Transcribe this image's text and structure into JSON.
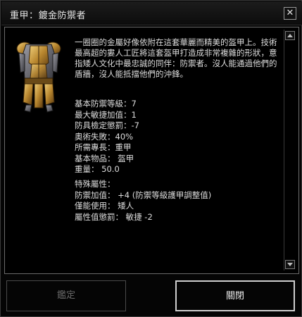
{
  "window": {
    "title": "重甲：鍍金防禦者",
    "close_glyph": "✕"
  },
  "item": {
    "image_icon": "gilded-armor-icon",
    "description": "一圈圈的金屬好像依附在這套華麗而精美的盔甲上。技術最高超的婁人工匠將這套盔甲打造成非常複雜的形狀，意指矮人文化中最忠誠的同伴：防禦者。沒人能通過他們的盾牆，沒人能抵擋他們的沖鋒。",
    "stats": [
      "基本防禦等級：7",
      "最大敏捷加值：1",
      "防具檢定懲罰：-7",
      "奧術失敗：40%",
      "所需專長：重甲",
      "基本物品： 盔甲",
      "重量： 50.0"
    ],
    "properties_header": "特殊屬性：",
    "properties": [
      "防禦加值： +4 (防禦等級護甲調整值)",
      "僅能使用： 矮人",
      "屬性值懲罰： 敏捷 -2"
    ]
  },
  "buttons": {
    "appraise": "鑑定",
    "close": "關閉"
  },
  "colors": {
    "gold": "#b8862e",
    "steel": "#6b6b72",
    "disabled_text": "#6a6a6a"
  }
}
